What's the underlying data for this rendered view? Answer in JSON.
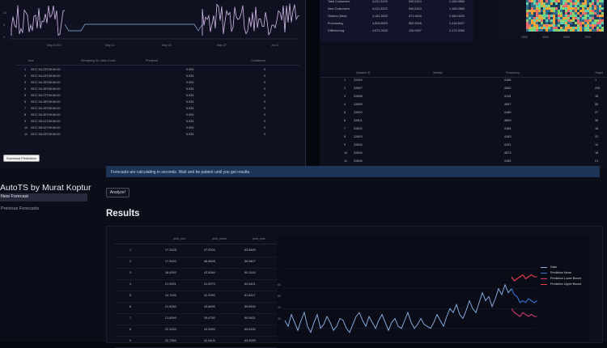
{
  "top_left": {
    "x_ticks": [
      "May 6\n2017",
      "May 13",
      "May 20",
      "May 27",
      "Jun 3"
    ],
    "y_ticks": [
      "10",
      "5",
      "0"
    ],
    "table": {
      "headers": [
        "time",
        "Remaining Air Visits Count",
        "Predicted",
        "Confidence"
      ],
      "rows": [
        [
          "1",
          "2017-04-23T00:00:00",
          "0.000",
          "0"
        ],
        [
          "2",
          "2017-04-24T00:00:00",
          "6.034",
          "0"
        ],
        [
          "3",
          "2017-04-25T00:00:00",
          "2.000",
          "0"
        ],
        [
          "4",
          "2017-04-26T00:00:00",
          "6.034",
          "0"
        ],
        [
          "5",
          "2017-04-27T00:00:00",
          "6.034",
          "0"
        ],
        [
          "6",
          "2017-04-28T00:00:00",
          "6.034",
          "0"
        ],
        [
          "7",
          "2017-04-29T00:00:00",
          "6.034",
          "0"
        ],
        [
          "8",
          "2017-04-30T00:00:00",
          "0.000",
          "0"
        ],
        [
          "9",
          "2017-05-01T00:00:00",
          "6.034",
          "0"
        ],
        [
          "10",
          "2017-05-02T00:00:00",
          "2.000",
          "0"
        ],
        [
          "11",
          "2017-05-03T00:00:00",
          "6.034",
          "0"
        ]
      ]
    },
    "download_button": "Download Predictions"
  },
  "top_right": {
    "summary_rows": [
      [
        "Total Customers",
        "4,411.3100",
        "540,2410",
        "1,165.0880"
      ],
      [
        "New Customers",
        "4,411.3223",
        "540,2410",
        "1,165.0880"
      ],
      [
        "Visitors (New)",
        "4,181.3033",
        "571.4620",
        "2,481.0020"
      ],
      [
        "Processing",
        "4,593.8003",
        "500.2006",
        "2,416.8937"
      ],
      [
        "Differencing",
        "4,571.3033",
        "126.0397",
        "2,174.3383"
      ]
    ],
    "heatmap_ticks": [
      "1500",
      "3500",
      "5500",
      "7500"
    ],
    "table": {
      "headers": [
        "",
        "Variable ID",
        "Identity",
        "Frequency",
        "Target"
      ],
      "rows": [
        [
          "1",
          "22494",
          "",
          "4186",
          "1"
        ],
        [
          "2",
          "22697",
          "",
          "4962",
          "205"
        ],
        [
          "3",
          "22698",
          "",
          "4119",
          "15"
        ],
        [
          "4",
          "22699",
          "",
          "4847",
          "55"
        ],
        [
          "5",
          "22600",
          "",
          "4180",
          "27"
        ],
        [
          "6",
          "22601",
          "",
          "4899",
          "35"
        ],
        [
          "7",
          "22602",
          "",
          "4184",
          "18"
        ],
        [
          "8",
          "22603",
          "",
          "4183",
          "22"
        ],
        [
          "9",
          "22604",
          "",
          "4191",
          "10"
        ],
        [
          "10",
          "22605",
          "",
          "4873",
          "18"
        ],
        [
          "11",
          "22606",
          "",
          "4182",
          "21"
        ]
      ]
    }
  },
  "sidebar": {
    "title": "AutoTS by Murat Koptur",
    "items": [
      "New Forecast",
      "Previous Forecasts"
    ]
  },
  "main": {
    "info_text": "Forecasts are calculating in seconds. Wait and be patient until you get results.",
    "analyze_button": "Analyze!",
    "results_heading": "Results",
    "results_table": {
      "headers": [
        "",
        "pred_min",
        "pred_mean",
        "pred_max"
      ],
      "rows": [
        [
          "1",
          "17.3028",
          "47.0004",
          "63.5669"
        ],
        [
          "2",
          "17.5020",
          "46.8808",
          "56.5807"
        ],
        [
          "3",
          "18.0053",
          "43.5084",
          "60.1543"
        ],
        [
          "4",
          "21.4901",
          "41.5973",
          "62.6421"
        ],
        [
          "5",
          "24.7495",
          "42.2052",
          "61.6417"
        ],
        [
          "6",
          "21.8284",
          "43.6695",
          "59.6592"
        ],
        [
          "7",
          "21.8999",
          "39.6750",
          "60.0821"
        ],
        [
          "8",
          "22.3253",
          "43.3392",
          "63.5432"
        ],
        [
          "9",
          "22.7983",
          "42.6404",
          "63.4059"
        ]
      ]
    },
    "chart": {
      "y_ticks": [
        "60",
        "50",
        "40",
        "30"
      ],
      "legend": [
        "Data",
        "Prediction Mean",
        "Prediction Lower Bound",
        "Prediction Upper Bound"
      ]
    }
  },
  "chart_data": {
    "type": "line",
    "series": [
      {
        "name": "Data",
        "values": [
          34,
          31,
          37,
          33,
          29,
          34,
          38,
          31,
          28,
          33,
          37,
          30,
          32,
          36,
          33,
          29,
          31,
          35,
          34,
          30,
          28,
          32,
          36,
          38,
          34,
          31,
          36,
          33,
          30,
          34,
          37,
          33,
          29,
          33,
          35,
          31,
          30,
          34,
          38,
          33,
          30,
          32,
          35,
          32,
          31,
          30,
          33,
          37,
          34,
          31,
          36,
          40,
          38,
          42,
          37,
          35,
          39,
          44,
          40,
          38,
          43,
          48,
          44,
          46,
          41,
          45,
          50,
          47,
          52,
          48,
          50
        ]
      },
      {
        "name": "Prediction Mean",
        "values": [
          50,
          47,
          46,
          43,
          44,
          43,
          45,
          44,
          43,
          44
        ]
      },
      {
        "name": "Prediction Lower Bound",
        "values": [
          40,
          38,
          37,
          36,
          38,
          37,
          36,
          37,
          36,
          36
        ]
      },
      {
        "name": "Prediction Upper Bound",
        "values": [
          56,
          54,
          55,
          56,
          57,
          55,
          56,
          57,
          56,
          56
        ]
      }
    ],
    "ylim": [
      25,
      65
    ],
    "colors": {
      "Data": "#8fb6ea",
      "Prediction Mean": "#3b6fd6",
      "Prediction Lower Bound": "#d23a6a",
      "Prediction Upper Bound": "#f04050"
    }
  }
}
